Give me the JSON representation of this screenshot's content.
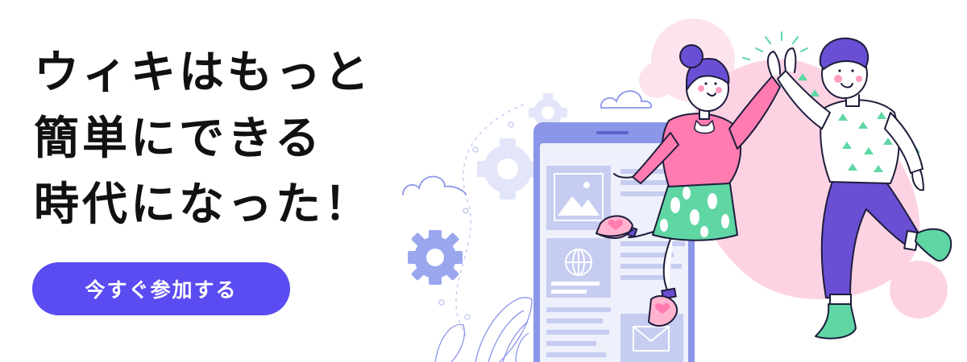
{
  "headline": {
    "line1": "ウィキはもっと",
    "line2": "簡単にできる",
    "line3": "時代になった！"
  },
  "cta": {
    "label": "今すぐ参加する"
  },
  "colors": {
    "accent": "#5a4cf0",
    "pink": "#ff7bb0",
    "blob_pink": "#fdd3e4",
    "green": "#5fd6a4",
    "purple": "#6a4fd4",
    "phone_blue": "#8b96e9"
  },
  "icons": [
    "gear-icon",
    "cloud-icon",
    "image-icon",
    "globe-icon",
    "mail-icon",
    "heart-icon",
    "cat-face-icon"
  ]
}
